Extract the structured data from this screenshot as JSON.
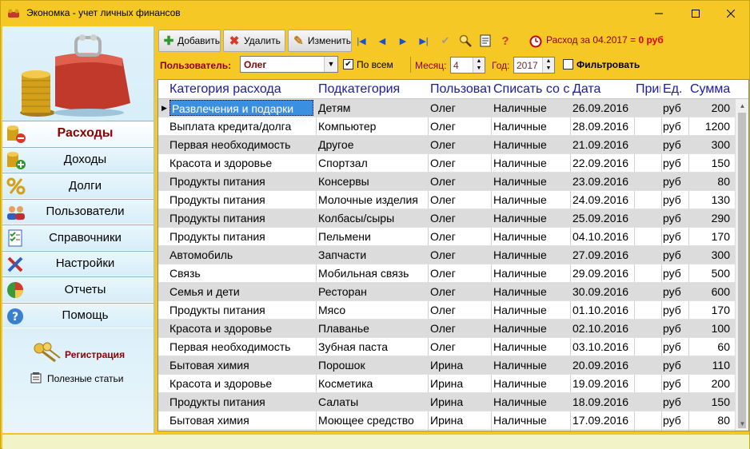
{
  "window": {
    "title": "Экономка - учет личных финансов"
  },
  "sidebar": {
    "items": [
      {
        "label": "Расходы",
        "icon": "coins-minus-icon"
      },
      {
        "label": "Доходы",
        "icon": "coins-plus-icon"
      },
      {
        "label": "Долги",
        "icon": "percent-icon"
      },
      {
        "label": "Пользователи",
        "icon": "users-icon"
      },
      {
        "label": "Справочники",
        "icon": "checklist-icon"
      },
      {
        "label": "Настройки",
        "icon": "tools-icon"
      },
      {
        "label": "Отчеты",
        "icon": "pie-chart-icon"
      },
      {
        "label": "Помощь",
        "icon": "help-icon"
      }
    ],
    "registration": "Регистрация",
    "articles": "Полезные статьи"
  },
  "toolbar": {
    "add_label": "Добавить",
    "delete_label": "Удалить",
    "edit_label": "Изменить",
    "summary_prefix": "Расход за 04.2017 =",
    "summary_value": "0 руб"
  },
  "filter": {
    "user_label": "Пользователь:",
    "user_value": "Олег",
    "all_label": "По всем",
    "all_checked": true,
    "month_label": "Месяц:",
    "month_value": "4",
    "year_label": "Год:",
    "year_value": "2017",
    "filter_label": "Фильтровать",
    "filter_checked": false
  },
  "grid": {
    "columns": [
      "Категория расхода",
      "Подкатегория",
      "Пользователь",
      "Списать со счета",
      "Дата",
      "Примечание",
      "Ед.",
      "Сумма"
    ],
    "rows": [
      [
        "Развлечения и подарки",
        "Детям",
        "Олег",
        "Наличные",
        "26.09.2016",
        "",
        "руб",
        "200"
      ],
      [
        "Выплата кредита/долга",
        "Компьютер",
        "Олег",
        "Наличные",
        "28.09.2016",
        "",
        "руб",
        "1200"
      ],
      [
        "Первая необходимость",
        "Другое",
        "Олег",
        "Наличные",
        "21.09.2016",
        "",
        "руб",
        "300"
      ],
      [
        "Красота и здоровье",
        "Спортзал",
        "Олег",
        "Наличные",
        "22.09.2016",
        "",
        "руб",
        "150"
      ],
      [
        "Продукты питания",
        "Консервы",
        "Олег",
        "Наличные",
        "23.09.2016",
        "",
        "руб",
        "80"
      ],
      [
        "Продукты питания",
        "Молочные изделия",
        "Олег",
        "Наличные",
        "24.09.2016",
        "",
        "руб",
        "130"
      ],
      [
        "Продукты питания",
        "Колбасы/сыры",
        "Олег",
        "Наличные",
        "25.09.2016",
        "",
        "руб",
        "290"
      ],
      [
        "Продукты питания",
        "Пельмени",
        "Олег",
        "Наличные",
        "04.10.2016",
        "",
        "руб",
        "170"
      ],
      [
        "Автомобиль",
        "Запчасти",
        "Олег",
        "Наличные",
        "27.09.2016",
        "",
        "руб",
        "300"
      ],
      [
        "Связь",
        "Мобильная связь",
        "Олег",
        "Наличные",
        "29.09.2016",
        "",
        "руб",
        "500"
      ],
      [
        "Семья и дети",
        "Ресторан",
        "Олег",
        "Наличные",
        "30.09.2016",
        "",
        "руб",
        "600"
      ],
      [
        "Продукты питания",
        "Мясо",
        "Олег",
        "Наличные",
        "01.10.2016",
        "",
        "руб",
        "170"
      ],
      [
        "Красота и здоровье",
        "Плаванье",
        "Олег",
        "Наличные",
        "02.10.2016",
        "",
        "руб",
        "100"
      ],
      [
        "Первая необходимость",
        "Зубная паста",
        "Олег",
        "Наличные",
        "03.10.2016",
        "",
        "руб",
        "60"
      ],
      [
        "Бытовая химия",
        "Порошок",
        "Ирина",
        "Наличные",
        "20.09.2016",
        "",
        "руб",
        "110"
      ],
      [
        "Красота и здоровье",
        "Косметика",
        "Ирина",
        "Наличные",
        "19.09.2016",
        "",
        "руб",
        "200"
      ],
      [
        "Продукты питания",
        "Салаты",
        "Ирина",
        "Наличные",
        "18.09.2016",
        "",
        "руб",
        "150"
      ],
      [
        "Бытовая химия",
        "Моющее средство",
        "Ирина",
        "Наличные",
        "17.09.2016",
        "",
        "руб",
        "80"
      ]
    ]
  }
}
